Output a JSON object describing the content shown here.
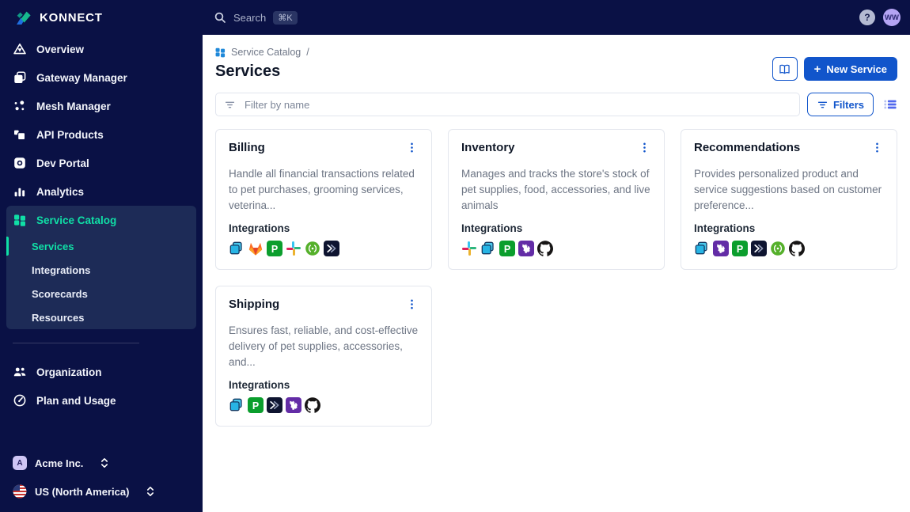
{
  "colors": {
    "navy": "#0a1145",
    "navy_highlight": "#1d2b57",
    "teal_accent": "#10dfa6",
    "primary_blue": "#1155cb",
    "breadcrumb_icon_blue": "#1e88d9",
    "text_dark": "#0f1729",
    "text_gray": "#6d7584",
    "card_border": "#e4e7ee"
  },
  "brand": {
    "name": "KONNECT"
  },
  "topbar": {
    "search_label": "Search",
    "search_shortcut": "⌘K",
    "help_label": "?",
    "avatar_initials": "WW"
  },
  "sidebar": {
    "items": [
      {
        "label": "Overview"
      },
      {
        "label": "Gateway Manager"
      },
      {
        "label": "Mesh Manager"
      },
      {
        "label": "API Products"
      },
      {
        "label": "Dev Portal"
      },
      {
        "label": "Analytics"
      },
      {
        "label": "Service Catalog"
      }
    ],
    "catalog_children": [
      {
        "label": "Services",
        "active": true
      },
      {
        "label": "Integrations"
      },
      {
        "label": "Scorecards"
      },
      {
        "label": "Resources"
      }
    ],
    "lower_items": [
      {
        "label": "Organization"
      },
      {
        "label": "Plan and Usage"
      }
    ],
    "org_switcher": {
      "label": "Acme Inc.",
      "initial": "A"
    },
    "region_switcher": {
      "label": "US (North America)"
    }
  },
  "header": {
    "breadcrumb": "Service Catalog",
    "separator": "/",
    "title": "Services",
    "plus": "+",
    "new_service_label": "New Service"
  },
  "filter_bar": {
    "placeholder": "Filter by name",
    "filters_label": "Filters"
  },
  "cards": [
    {
      "title": "Billing",
      "description": "Handle all financial transactions related to pet purchases, grooming services, veterina...",
      "integrations_label": "Integrations",
      "integrations": [
        "gateway",
        "gitlab",
        "pagerduty",
        "slack",
        "swaggerhub",
        "traceable"
      ]
    },
    {
      "title": "Inventory",
      "description": "Manages and tracks the store's stock of pet supplies, food, accessories, and live animals",
      "integrations_label": "Integrations",
      "integrations": [
        "slack",
        "gateway",
        "pagerduty",
        "datadog",
        "github"
      ]
    },
    {
      "title": "Recommendations",
      "description": "Provides personalized product and service suggestions based on customer preference...",
      "integrations_label": "Integrations",
      "integrations": [
        "gateway",
        "datadog",
        "pagerduty",
        "traceable",
        "swaggerhub",
        "github"
      ]
    },
    {
      "title": "Shipping",
      "description": "Ensures fast, reliable, and cost-effective delivery of pet supplies, accessories, and...",
      "integrations_label": "Integrations",
      "integrations": [
        "gateway",
        "pagerduty",
        "traceable",
        "datadog",
        "github"
      ]
    }
  ],
  "icon_names": {
    "gateway": "Kong Gateway",
    "gitlab": "GitLab",
    "pagerduty": "PagerDuty",
    "slack": "Slack",
    "swaggerhub": "SwaggerHub",
    "traceable": "Traceable",
    "datadog": "Datadog",
    "github": "GitHub"
  }
}
